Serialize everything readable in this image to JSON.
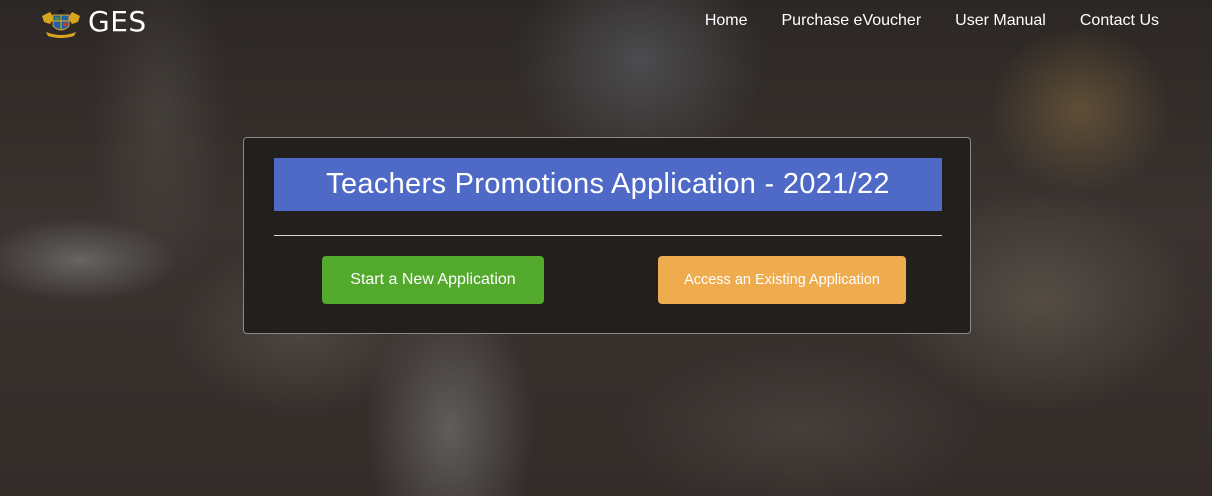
{
  "navbar": {
    "brand_text": "GES",
    "brand_icon": "coat-of-arms-icon",
    "links": [
      {
        "label": "Home"
      },
      {
        "label": "Purchase eVoucher"
      },
      {
        "label": "User Manual"
      },
      {
        "label": "Contact Us"
      }
    ]
  },
  "card": {
    "title": "Teachers Promotions Application - 2021/22",
    "start_button": "Start a New Application",
    "access_button": "Access an Existing Application"
  },
  "colors": {
    "title_bg": "#4f69c6",
    "start_bg": "#52a92b",
    "access_bg": "#efac4e",
    "card_bg": "#231f1d"
  }
}
